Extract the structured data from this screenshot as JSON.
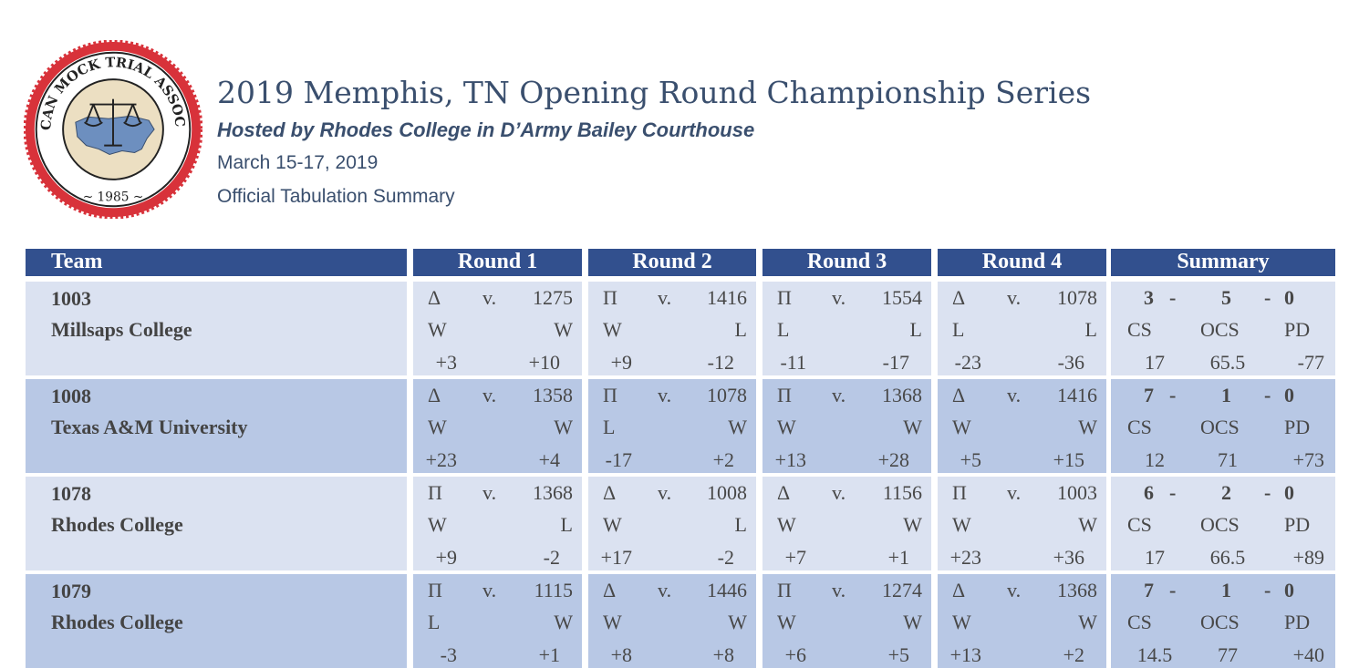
{
  "header": {
    "seal_text": "AMERICAN MOCK TRIAL ASSOCIATION",
    "seal_year": "~ 1985 ~",
    "title": "2019 Memphis, TN Opening Round Championship Series",
    "subtitle": "Hosted by Rhodes College in D’Army Bailey Courthouse",
    "dates": "March 15-17, 2019",
    "official": "Official Tabulation Summary"
  },
  "columns": {
    "team": "Team",
    "round1": "Round 1",
    "round2": "Round 2",
    "round3": "Round 3",
    "round4": "Round 4",
    "summary": "Summary"
  },
  "labels": {
    "v": "v.",
    "cs": "CS",
    "ocs": "OCS",
    "pd": "PD"
  },
  "teams": [
    {
      "number": "1003",
      "name": "Millsaps College",
      "rounds": [
        {
          "side": "Δ",
          "opp": "1275",
          "b1": "W",
          "b2": "W",
          "pd1": "+3",
          "pd2": "+10"
        },
        {
          "side": "Π",
          "opp": "1416",
          "b1": "W",
          "b2": "L",
          "pd1": "+9",
          "pd2": "-12"
        },
        {
          "side": "Π",
          "opp": "1554",
          "b1": "L",
          "b2": "L",
          "pd1": "-11",
          "pd2": "-17"
        },
        {
          "side": "Δ",
          "opp": "1078",
          "b1": "L",
          "b2": "L",
          "pd1": "-23",
          "pd2": "-36"
        }
      ],
      "summary": {
        "wins": "3",
        "losses": "5",
        "ties": "0",
        "cs": "17",
        "ocs": "65.5",
        "pd": "-77"
      }
    },
    {
      "number": "1008",
      "name": "Texas A&M University",
      "rounds": [
        {
          "side": "Δ",
          "opp": "1358",
          "b1": "W",
          "b2": "W",
          "pd1": "+23",
          "pd2": "+4"
        },
        {
          "side": "Π",
          "opp": "1078",
          "b1": "L",
          "b2": "W",
          "pd1": "-17",
          "pd2": "+2"
        },
        {
          "side": "Π",
          "opp": "1368",
          "b1": "W",
          "b2": "W",
          "pd1": "+13",
          "pd2": "+28"
        },
        {
          "side": "Δ",
          "opp": "1416",
          "b1": "W",
          "b2": "W",
          "pd1": "+5",
          "pd2": "+15"
        }
      ],
      "summary": {
        "wins": "7",
        "losses": "1",
        "ties": "0",
        "cs": "12",
        "ocs": "71",
        "pd": "+73"
      }
    },
    {
      "number": "1078",
      "name": "Rhodes College",
      "rounds": [
        {
          "side": "Π",
          "opp": "1368",
          "b1": "W",
          "b2": "L",
          "pd1": "+9",
          "pd2": "-2"
        },
        {
          "side": "Δ",
          "opp": "1008",
          "b1": "W",
          "b2": "L",
          "pd1": "+17",
          "pd2": "-2"
        },
        {
          "side": "Δ",
          "opp": "1156",
          "b1": "W",
          "b2": "W",
          "pd1": "+7",
          "pd2": "+1"
        },
        {
          "side": "Π",
          "opp": "1003",
          "b1": "W",
          "b2": "W",
          "pd1": "+23",
          "pd2": "+36"
        }
      ],
      "summary": {
        "wins": "6",
        "losses": "2",
        "ties": "0",
        "cs": "17",
        "ocs": "66.5",
        "pd": "+89"
      }
    },
    {
      "number": "1079",
      "name": "Rhodes College",
      "rounds": [
        {
          "side": "Π",
          "opp": "1115",
          "b1": "L",
          "b2": "W",
          "pd1": "-3",
          "pd2": "+1"
        },
        {
          "side": "Δ",
          "opp": "1446",
          "b1": "W",
          "b2": "W",
          "pd1": "+8",
          "pd2": "+8"
        },
        {
          "side": "Π",
          "opp": "1274",
          "b1": "W",
          "b2": "W",
          "pd1": "+6",
          "pd2": "+5"
        },
        {
          "side": "Δ",
          "opp": "1368",
          "b1": "W",
          "b2": "W",
          "pd1": "+13",
          "pd2": "+2"
        }
      ],
      "summary": {
        "wins": "7",
        "losses": "1",
        "ties": "0",
        "cs": "14.5",
        "ocs": "77",
        "pd": "+40"
      }
    }
  ],
  "colors": {
    "header_bg": "#32508e",
    "row_light": "#dbe2f1",
    "row_dark": "#b8c8e5",
    "title_text": "#3a4f6e",
    "seal_red": "#d8323a",
    "seal_cream": "#ecdfc2",
    "map_blue": "#6d8fbf"
  }
}
